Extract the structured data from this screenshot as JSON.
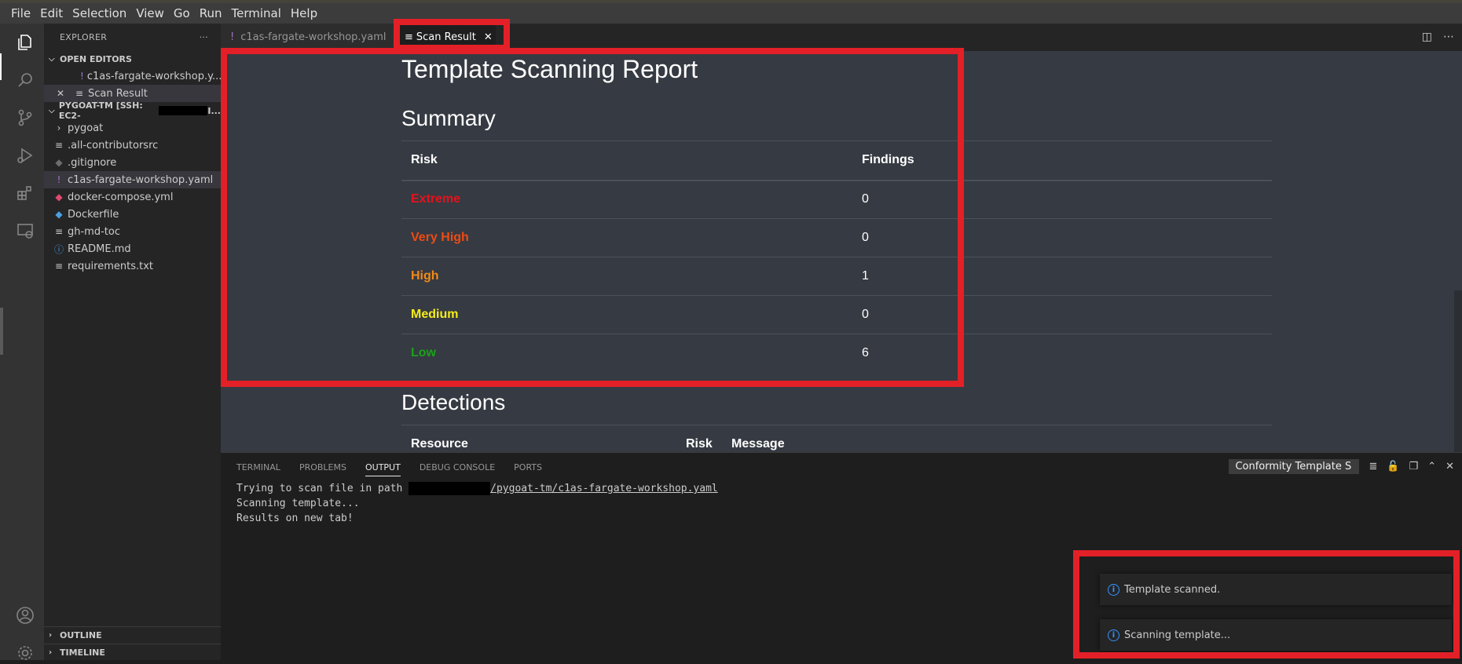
{
  "menu": [
    "File",
    "Edit",
    "Selection",
    "View",
    "Go",
    "Run",
    "Terminal",
    "Help"
  ],
  "sidebar": {
    "title": "EXPLORER",
    "more": "···",
    "open_editors_label": "OPEN EDITORS",
    "open_editors": [
      {
        "name": "c1as-fargate-workshop.y...",
        "icon": "yaml-exclamation-icon"
      },
      {
        "name": "Scan Result",
        "icon": "lines-icon"
      }
    ],
    "workspace_label_prefix": "PYGOAT-TM [SSH: EC2-",
    "workspace_label_suffix": "I...",
    "files": [
      {
        "name": "pygoat",
        "type": "folder"
      },
      {
        "name": ".all-contributorsrc",
        "icon": "≡"
      },
      {
        "name": ".gitignore",
        "icon": "◆"
      },
      {
        "name": "c1as-fargate-workshop.yaml",
        "icon": "!"
      },
      {
        "name": "docker-compose.yml",
        "icon": "🐳"
      },
      {
        "name": "Dockerfile",
        "icon": "🐳"
      },
      {
        "name": "gh-md-toc",
        "icon": "≡"
      },
      {
        "name": "README.md",
        "icon": "ⓘ"
      },
      {
        "name": "requirements.txt",
        "icon": "≡"
      }
    ],
    "outline_label": "OUTLINE",
    "timeline_label": "TIMELINE"
  },
  "tabs": {
    "yaml_tab": "c1as-fargate-workshop.yaml",
    "scan_tab": "Scan Result"
  },
  "report": {
    "title": "Template Scanning Report",
    "summary_heading": "Summary",
    "col_risk": "Risk",
    "col_findings": "Findings",
    "rows": [
      {
        "risk": "Extreme",
        "count": "0",
        "color": "#e8111b"
      },
      {
        "risk": "Very High",
        "count": "0",
        "color": "#ee4b14"
      },
      {
        "risk": "High",
        "count": "1",
        "color": "#f28a18"
      },
      {
        "risk": "Medium",
        "count": "0",
        "color": "#f4ec1a"
      },
      {
        "risk": "Low",
        "count": "6",
        "color": "#18a318"
      }
    ],
    "detections_heading": "Detections",
    "det_col_resource": "Resource",
    "det_col_risk": "Risk",
    "det_col_message": "Message"
  },
  "panel": {
    "tabs": [
      "TERMINAL",
      "PROBLEMS",
      "OUTPUT",
      "DEBUG CONSOLE",
      "PORTS"
    ],
    "channel": "Conformity Template S",
    "output_line1_prefix": "Trying to scan file in path ",
    "output_line1_path": "/pygoat-tm/c1as-fargate-workshop.yaml",
    "output_line2": "Scanning template...",
    "output_line3": "Results on new tab!"
  },
  "notifications": [
    {
      "text": "Template scanned."
    },
    {
      "text": "Scanning template..."
    }
  ],
  "colors": {
    "highlight_box": "#e32027",
    "accent_info": "#3794ff"
  }
}
